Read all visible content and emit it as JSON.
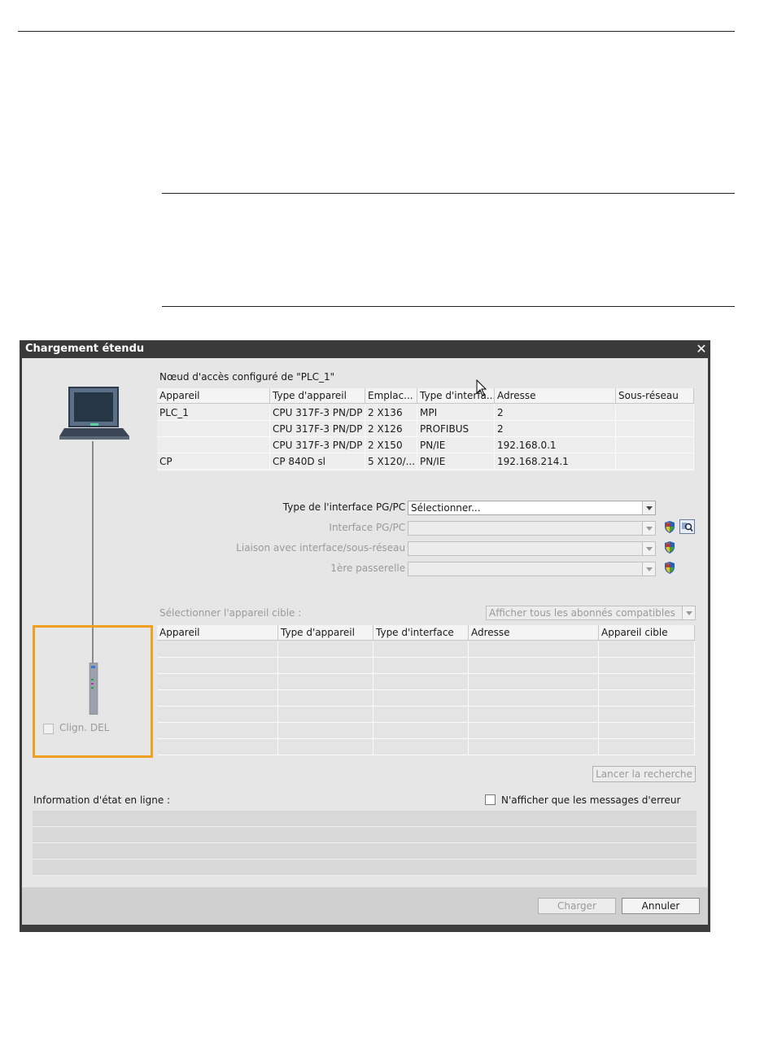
{
  "dialog": {
    "title": "Chargement étendu",
    "close_glyph": "✕"
  },
  "configured": {
    "heading": "Nœud d'accès configuré de \"PLC_1\"",
    "columns": [
      "Appareil",
      "Type d'appareil",
      "Emplac...",
      "Type d'interfa...",
      "Adresse",
      "Sous-réseau"
    ],
    "rows": [
      [
        "PLC_1",
        "CPU 317F-3 PN/DP",
        "2 X136",
        "MPI",
        "2",
        ""
      ],
      [
        "",
        "CPU 317F-3 PN/DP",
        "2 X126",
        "PROFIBUS",
        "2",
        ""
      ],
      [
        "",
        "CPU 317F-3 PN/DP",
        "2 X150",
        "PN/IE",
        "192.168.0.1",
        ""
      ],
      [
        "CP",
        "CP 840D sl",
        "5 X120/...",
        "PN/IE",
        "192.168.214.1",
        ""
      ]
    ]
  },
  "form": {
    "pgpc_type_label": "Type de l'interface PG/PC :",
    "pgpc_type_value": "Sélectionner...",
    "pgpc_iface_label": "Interface PG/PC :",
    "link_label": "Liaison avec interface/sous-réseau :",
    "gateway_label": "1ère passerelle :"
  },
  "target": {
    "label": "Sélectionner l'appareil cible :",
    "filter_value": "Afficher tous les abonnés compatibles",
    "columns": [
      "Appareil",
      "Type d'appareil",
      "Type d'interface",
      "Adresse",
      "Appareil cible"
    ],
    "empty_rows": 7
  },
  "left_panel": {
    "blink_label": "Clign. DEL"
  },
  "search_button": "Lancer la recherche",
  "status": {
    "label": "Information d'état en ligne :",
    "errors_only_label": "N'afficher que les messages d'erreur"
  },
  "footer": {
    "load_label": "Charger",
    "cancel_label": "Annuler"
  },
  "icons": [
    "laptop-icon",
    "plc-device-icon",
    "shield-icon",
    "search-device-icon",
    "mouse-cursor-icon"
  ],
  "colors": {
    "highlight": "#f0a020",
    "titlebar": "#3a3a3a"
  }
}
